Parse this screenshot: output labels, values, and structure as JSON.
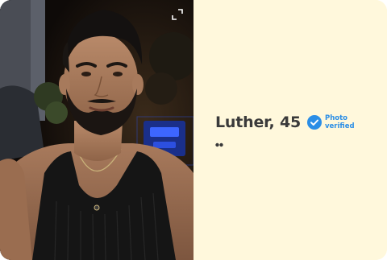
{
  "profile": {
    "name_age": "Luther, 45",
    "verified_label": "Photo verified"
  },
  "icons": {
    "expand": "expand-icon",
    "verified": "verified-check-icon",
    "quote": "quote-icon"
  },
  "colors": {
    "card_background": "#fff8dc",
    "verified_blue": "#2b8ee6",
    "name_text": "#3a3a3a"
  }
}
